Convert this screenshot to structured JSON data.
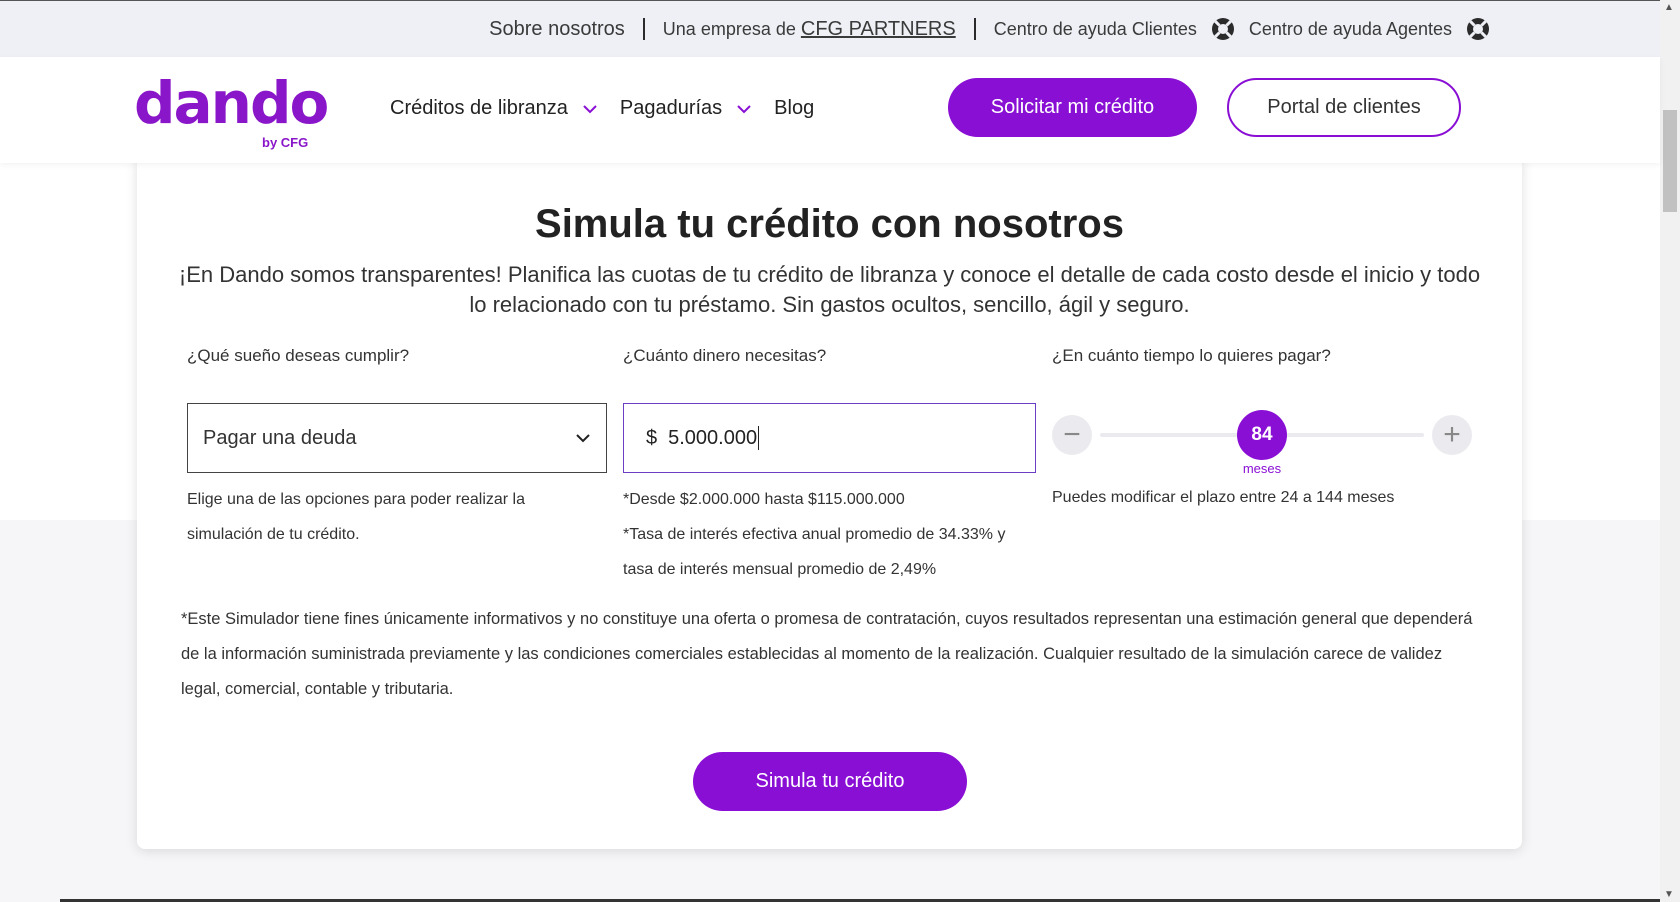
{
  "topbar": {
    "about": "Sobre nosotros",
    "company_prefix": "Una empresa de",
    "company_link": "CFG PARTNERS",
    "help_clients": "Centro de ayuda Clientes",
    "help_agents": "Centro de ayuda Agentes"
  },
  "header": {
    "logo_word": "dando",
    "logo_sub": "by CFG",
    "nav": [
      {
        "label": "Créditos de libranza"
      },
      {
        "label": "Pagadurías"
      },
      {
        "label": "Blog"
      }
    ],
    "cta_primary": "Solicitar mi crédito",
    "cta_secondary": "Portal de clientes"
  },
  "simulator": {
    "title": "Simula tu crédito con nosotros",
    "subtitle": "¡En Dando somos transparentes! Planifica las cuotas de tu crédito de libranza y conoce el detalle de cada costo desde el inicio y todo lo relacionado con tu préstamo. Sin gastos ocultos, sencillo, ágil y seguro.",
    "dream": {
      "label": "¿Qué sueño deseas cumplir?",
      "value": "Pagar una deuda",
      "help": "Elige una de las opciones para poder realizar la simulación de tu crédito."
    },
    "amount": {
      "label": "¿Cuánto dinero necesitas?",
      "currency": "$",
      "value": "5.000.000",
      "help_range": "*Desde $2.000.000 hasta $115.000.000",
      "help_rate": "*Tasa de interés efectiva anual promedio de 34.33% y tasa de interés mensual promedio de 2,49%"
    },
    "term": {
      "label": "¿En cuánto tiempo lo quieres pagar?",
      "value": "84",
      "unit": "meses",
      "min": 24,
      "max": 144,
      "fraction": 0.5,
      "help": "Puedes modificar el plazo entre 24 a 144 meses"
    },
    "disclaimer": "*Este Simulador tiene fines únicamente informativos y no constituye una oferta o promesa de contratación, cuyos resultados representan una estimación general que dependerá de la información suministrada previamente y las condiciones comerciales establecidas al momento de la realización. Cualquier resultado de la simulación carece de validez legal, comercial, contable y tributaria.",
    "submit": "Simula tu crédito"
  },
  "icons": {
    "help": "lifebuoy-icon",
    "chevron": "chevron-down-icon",
    "minus": "minus-icon",
    "plus": "plus-icon"
  },
  "colors": {
    "brand": "#8a0fd4",
    "topbar_bg": "#eef0f5"
  }
}
